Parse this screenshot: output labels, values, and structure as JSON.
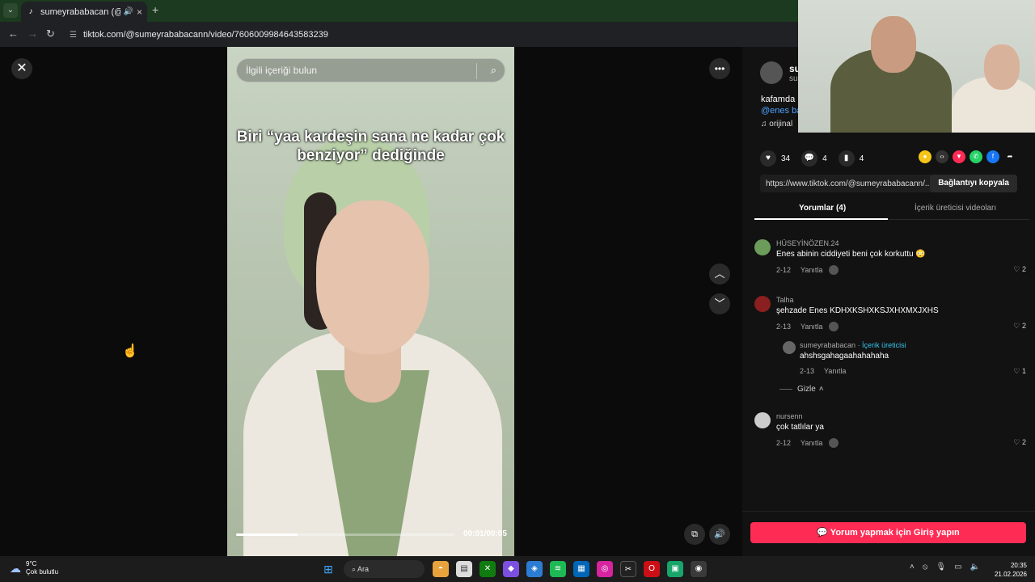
{
  "browser": {
    "tab_title": "sumeyrababacan (@sumey",
    "new_tab": "+",
    "url": "tiktok.com/@sumeyrababacann/video/7606009984643583239"
  },
  "video": {
    "search_placeholder": "İlgili içeriği bulun",
    "caption": "Biri “yaa kardeşin sana ne kadar çok benziyor” dediğinde",
    "time": "00:01/00:05",
    "progress_fraction": 0.28
  },
  "author": {
    "name": "su",
    "handle": "sur",
    "description": "kafamda",
    "mention": "@enes ba",
    "music": "orijinal"
  },
  "actions": {
    "likes": "34",
    "comments": "4",
    "saves": "4"
  },
  "link": {
    "url": "https://www.tiktok.com/@sumeyrababacann/...",
    "copy_label": "Bağlantıyı kopyala"
  },
  "tabs": {
    "comments": "Yorumlar (4)",
    "creator_videos": "İçerik üreticisi videoları"
  },
  "comments": [
    {
      "user": "HÜSEYİNÖZEN.24",
      "text": "Enes abinin ciddiyeti beni çok korkuttu 😳",
      "date": "2-12",
      "reply": "Yanıtla",
      "likes": "2"
    },
    {
      "user": "Talha",
      "text": "şehzade Enes KDHXKSHXKSJXHXMXJXHS",
      "date": "2-13",
      "reply": "Yanıtla",
      "likes": "2"
    },
    {
      "user": "sumeyrababacan",
      "creator_tag": "· İçerik üreticisi",
      "text": "ahshsgahagaahahahaha",
      "date": "2-13",
      "reply": "Yanıtla",
      "likes": "1"
    },
    {
      "user": "nursenn",
      "text": "çok tatlılar ya",
      "date": "2-12",
      "reply": "Yanıtla",
      "likes": "2"
    }
  ],
  "hide_label": "Gizle",
  "login_label": "Yorum yapmak için Giriş yapın",
  "taskbar": {
    "temp": "9°C",
    "weather": "Çok bulutlu",
    "search": "Ara",
    "time": "20:35",
    "date": "21.02.2026"
  },
  "colors": {
    "accent": "#fe2c55",
    "creator": "#34c4e8",
    "mention": "#4da3ff"
  }
}
